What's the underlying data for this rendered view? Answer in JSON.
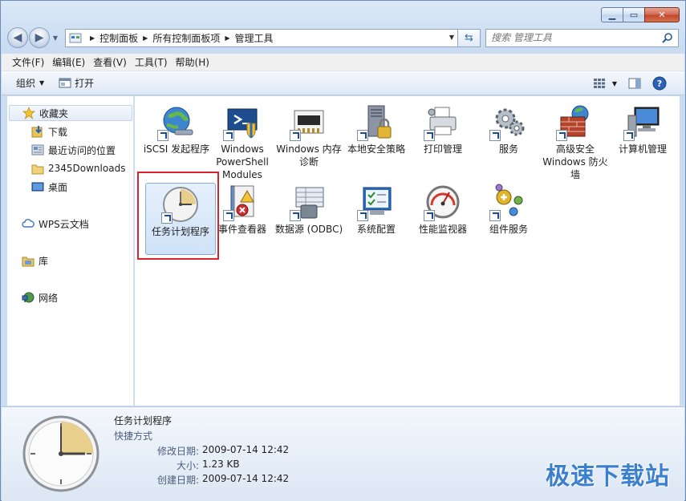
{
  "address": {
    "crumbs": [
      "控制面板",
      "所有控制面板项",
      "管理工具"
    ]
  },
  "search": {
    "placeholder": "搜索 管理工具"
  },
  "menu": [
    "文件(F)",
    "编辑(E)",
    "查看(V)",
    "工具(T)",
    "帮助(H)"
  ],
  "toolbar": {
    "organize": "组织",
    "open": "打开"
  },
  "nav": {
    "favorites": "收藏夹",
    "downloads": "下载",
    "recent": "最近访问的位置",
    "folder_2345": "2345Downloads",
    "desktop": "桌面",
    "wps": "WPS云文档",
    "library": "库",
    "network": "网络"
  },
  "items": [
    {
      "label": "iSCSI 发起程序",
      "icon": "globe-network-icon"
    },
    {
      "label": "Windows PowerShell Modules",
      "icon": "powershell-icon"
    },
    {
      "label": "Windows 内存诊断",
      "icon": "memory-chip-icon"
    },
    {
      "label": "本地安全策略",
      "icon": "server-lock-icon"
    },
    {
      "label": "打印管理",
      "icon": "printer-icon"
    },
    {
      "label": "服务",
      "icon": "gears-icon"
    },
    {
      "label": "高级安全 Windows 防火墙",
      "icon": "firewall-icon"
    },
    {
      "label": "计算机管理",
      "icon": "computer-icon"
    },
    {
      "label": "任务计划程序",
      "icon": "clock-icon"
    },
    {
      "label": "事件查看器",
      "icon": "event-book-icon"
    },
    {
      "label": "数据源 (ODBC)",
      "icon": "database-icon"
    },
    {
      "label": "系统配置",
      "icon": "system-config-icon"
    },
    {
      "label": "性能监视器",
      "icon": "gauge-icon"
    },
    {
      "label": "组件服务",
      "icon": "component-icon"
    }
  ],
  "details": {
    "name": "任务计划程序",
    "type": "快捷方式",
    "modified_label": "修改日期:",
    "modified": "2009-07-14 12:42",
    "size_label": "大小:",
    "size": "1.23 KB",
    "created_label": "创建日期:",
    "created": "2009-07-14 12:42"
  },
  "watermark": "极速下载站"
}
